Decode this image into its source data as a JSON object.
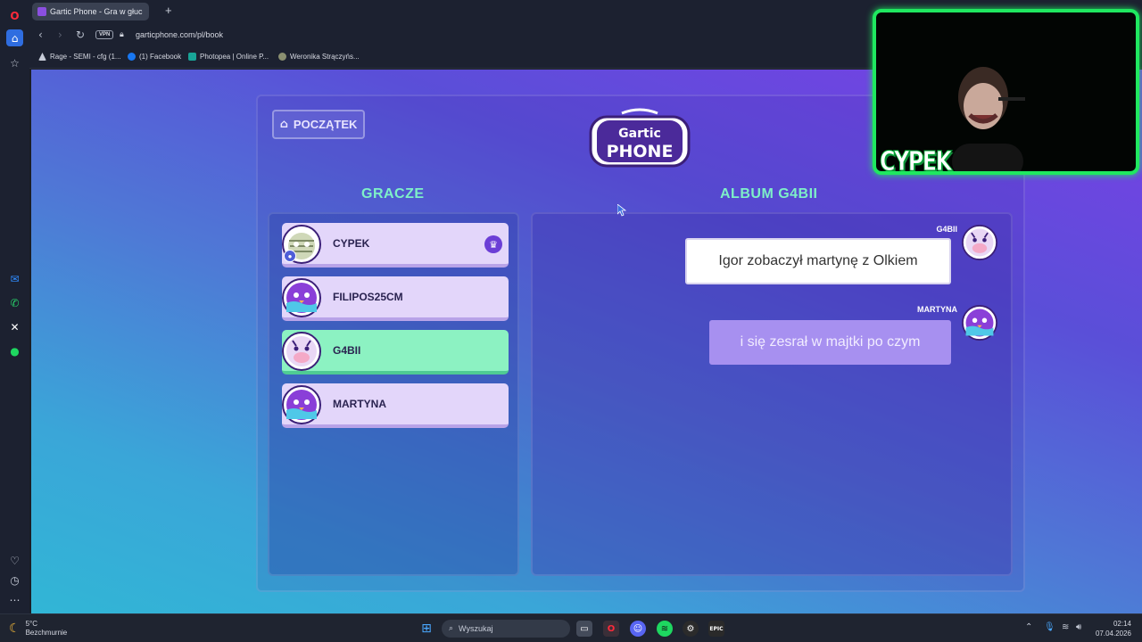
{
  "browser": {
    "tab_title": "Gartic Phone - Gra w głuc",
    "url": "garticphone.com/pl/book",
    "vpn_label": "VPN",
    "bookmarks": [
      {
        "label": "Rage - SEMI - cfg (1..."
      },
      {
        "label": "(1) Facebook"
      },
      {
        "label": "Photopea | Online P..."
      },
      {
        "label": "Weronika Strączyńs..."
      }
    ]
  },
  "game": {
    "home_label": "POCZĄTEK",
    "logo_top": "Gartic",
    "logo_bottom": "PHONE",
    "players_title": "GRACZE",
    "album_title": "ALBUM G4BII",
    "players": [
      {
        "name": "CYPEK",
        "owner": true
      },
      {
        "name": "FILIPOS25CM",
        "owner": false
      },
      {
        "name": "G4BII",
        "owner": false
      },
      {
        "name": "MARTYNA",
        "owner": false
      }
    ],
    "album": [
      {
        "author": "G4BII",
        "text": "Igor zobaczył martynę z Olkiem"
      },
      {
        "author": "MARTYNA",
        "text": "i się zesrał w majtki po czym"
      }
    ]
  },
  "webcam": {
    "name": "CYPEK"
  },
  "taskbar": {
    "weather_temp": "5°C",
    "weather_desc": "Bezchmurnie",
    "search_placeholder": "Wyszukaj",
    "time": "02:14",
    "date": "07.04.2026"
  },
  "colors": {
    "accent_green": "#1fe860",
    "active_player": "#8cf2c2",
    "player_card": "#e3d6fa",
    "title_green": "#7ef0c8"
  }
}
